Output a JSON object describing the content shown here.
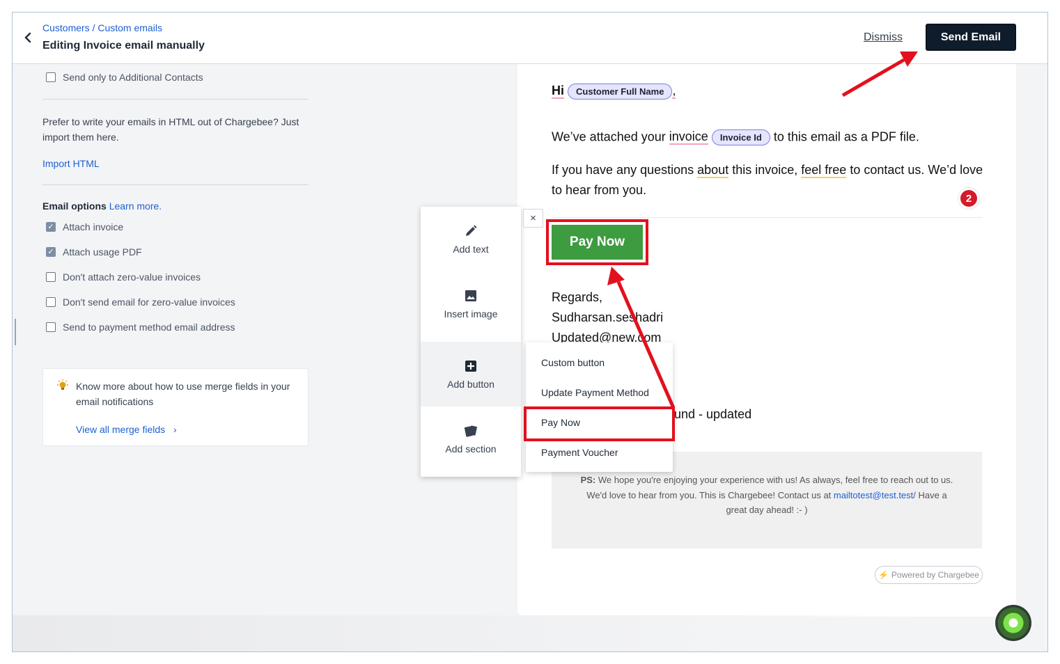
{
  "header": {
    "breadcrumb_customers": "Customers",
    "breadcrumb_sep": "/",
    "breadcrumb_custom_emails": "Custom emails",
    "title": "Editing Invoice email manually",
    "dismiss_label": "Dismiss",
    "send_label": "Send Email"
  },
  "left": {
    "send_only_additional": "Send only to Additional Contacts",
    "html_hint": "Prefer to write your emails in HTML out of Chargebee? Just import them here.",
    "import_html": "Import HTML",
    "email_options_label": "Email options",
    "learn_more": "Learn more.",
    "options": [
      {
        "label": "Attach invoice",
        "checked": true
      },
      {
        "label": "Attach usage PDF",
        "checked": true
      },
      {
        "label": "Don't attach zero-value invoices",
        "checked": false
      },
      {
        "label": "Don't send email for zero-value invoices",
        "checked": false
      },
      {
        "label": "Send to payment method email address",
        "checked": false
      }
    ],
    "tip_text": "Know more about how to use merge fields in your email notifications",
    "tip_link": "View all merge fields",
    "tip_link_chevron": "›"
  },
  "toolbox": {
    "items": [
      {
        "label": "Add text",
        "icon": "pencil-icon"
      },
      {
        "label": "Insert image",
        "icon": "image-icon"
      },
      {
        "label": "Add button",
        "icon": "plus-square-icon"
      },
      {
        "label": "Add section",
        "icon": "cards-icon"
      }
    ],
    "close_glyph": "×"
  },
  "dropdown": {
    "items": [
      "Custom button",
      "Update Payment Method",
      "Pay Now",
      "Payment Voucher"
    ]
  },
  "email": {
    "greeting": "Hi",
    "customer_chip": "Customer Full Name",
    "comma": ",",
    "line1_a": "We’ve attached your",
    "line1_invoice": "invoice",
    "invoice_chip": "Invoice Id",
    "line1_b": "to this email as a PDF file.",
    "line2_a": "If you have any questions",
    "line2_about": "about",
    "line2_b": "this invoice,",
    "line2_feel": "feel free",
    "line2_c": "to contact us. We’d love to hear from you.",
    "badge_count": "2",
    "pay_now": "Pay Now",
    "regards": "Regards,",
    "sender_name": "Sudharsan.seshadri",
    "sender_email": "Updated@new.com",
    "partial_text": "und - updated",
    "ps_label": "PS:",
    "ps_text": "We hope you're enjoying your experience with us! As always, feel free to reach out to us. We'd love to hear from you. This is Chargebee! Contact us at",
    "ps_link": "mailtotest@test.test",
    "ps_tail": "/ Have a great day ahead! :- )",
    "powered_by": "Powered by Chargebee"
  },
  "colors": {
    "accent_blue": "#1d5fd1",
    "send_button_bg": "#0f1c2b",
    "pay_now_green": "#3d9b40",
    "annotation_red": "#e3101d",
    "chip_bg": "#e5e5fb"
  }
}
